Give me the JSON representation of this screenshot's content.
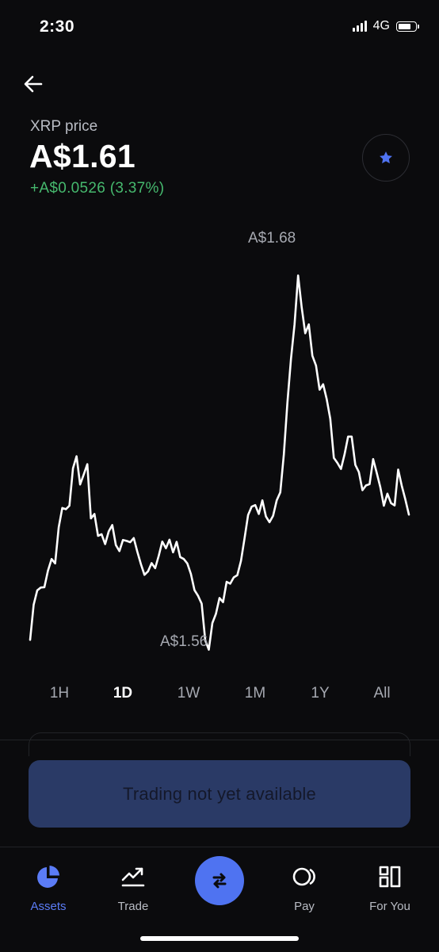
{
  "status": {
    "time": "2:30",
    "network": "4G"
  },
  "header": {
    "coin_label": "XRP price",
    "price": "A$1.61",
    "change": "+A$0.0526 (3.37%)"
  },
  "colors": {
    "accent": "#4f73f1",
    "positive": "#46b96e",
    "button_bg": "#2a3a66"
  },
  "chart_data": {
    "type": "line",
    "currency": "AUD",
    "high_label": "A$1.68",
    "low_label": "A$1.56",
    "ylim": [
      1.5533,
      1.6933
    ],
    "values": [
      1.5615,
      1.5726,
      1.5771,
      1.578,
      1.5781,
      1.5833,
      1.587,
      1.5856,
      1.597,
      1.6031,
      1.6027,
      1.6038,
      1.6156,
      1.6194,
      1.6105,
      1.6136,
      1.6169,
      1.5998,
      1.6012,
      1.5943,
      1.5948,
      1.5917,
      1.5957,
      1.5977,
      1.5914,
      1.5895,
      1.593,
      1.5927,
      1.5923,
      1.5936,
      1.5893,
      1.5854,
      1.582,
      1.5831,
      1.5857,
      1.5841,
      1.588,
      1.5925,
      1.5904,
      1.5931,
      1.5891,
      1.5924,
      1.5876,
      1.587,
      1.5856,
      1.5823,
      1.5772,
      1.5754,
      1.5729,
      1.5614,
      1.5584,
      1.5668,
      1.5697,
      1.5747,
      1.5734,
      1.5798,
      1.5792,
      1.5812,
      1.5819,
      1.5864,
      1.5935,
      1.6009,
      1.6035,
      1.604,
      1.6012,
      1.6055,
      1.6004,
      1.5986,
      1.6006,
      1.6055,
      1.608,
      1.62,
      1.6363,
      1.6501,
      1.661,
      1.6764,
      1.6664,
      1.6582,
      1.661,
      1.6511,
      1.648,
      1.6404,
      1.6421,
      1.6374,
      1.6312,
      1.6189,
      1.6173,
      1.6154,
      1.62,
      1.6256,
      1.6256,
      1.6167,
      1.6144,
      1.6087,
      1.6102,
      1.6106,
      1.6185,
      1.6142,
      1.6097,
      1.6038,
      1.6076,
      1.6046,
      1.6039,
      1.6152,
      1.6101,
      1.6058,
      1.601
    ]
  },
  "ranges": [
    {
      "label": "1H"
    },
    {
      "label": "1D",
      "active": true
    },
    {
      "label": "1W"
    },
    {
      "label": "1M"
    },
    {
      "label": "1Y"
    },
    {
      "label": "All"
    }
  ],
  "trade_button": {
    "label": "Trading not yet available"
  },
  "tabbar": {
    "assets": "Assets",
    "trade": "Trade",
    "pay": "Pay",
    "for_you": "For You"
  }
}
